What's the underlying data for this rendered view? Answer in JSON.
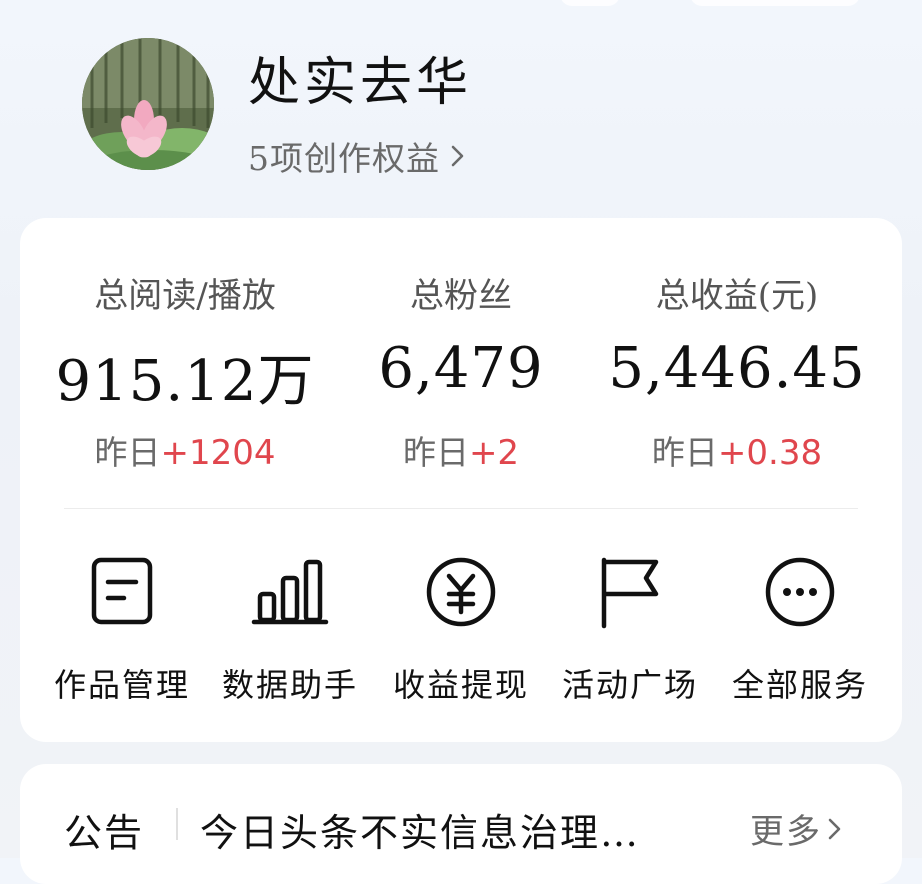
{
  "profile": {
    "name": "处实去华",
    "rights_link": "5项创作权益"
  },
  "stats": [
    {
      "label": "总阅读/播放",
      "value": "915.12万",
      "delta_label": "昨日",
      "delta_value": "+1204"
    },
    {
      "label": "总粉丝",
      "value": "6,479",
      "delta_label": "昨日",
      "delta_value": "+2"
    },
    {
      "label": "总收益(元)",
      "value": "5,446.45",
      "delta_label": "昨日",
      "delta_value": "+0.38"
    }
  ],
  "tools": [
    {
      "label": "作品管理",
      "icon": "document-icon"
    },
    {
      "label": "数据助手",
      "icon": "bar-chart-icon"
    },
    {
      "label": "收益提现",
      "icon": "yuan-coin-icon"
    },
    {
      "label": "活动广场",
      "icon": "flag-icon"
    },
    {
      "label": "全部服务",
      "icon": "more-icon"
    }
  ],
  "notice": {
    "tag": "公告",
    "text": "今日头条不实信息治理…",
    "more": "更多"
  },
  "colors": {
    "accent_red": "#e0464d",
    "text_primary": "#111111",
    "text_secondary": "#6a6a6a",
    "card_bg": "#ffffff",
    "page_bg": "#f1f4f9"
  }
}
